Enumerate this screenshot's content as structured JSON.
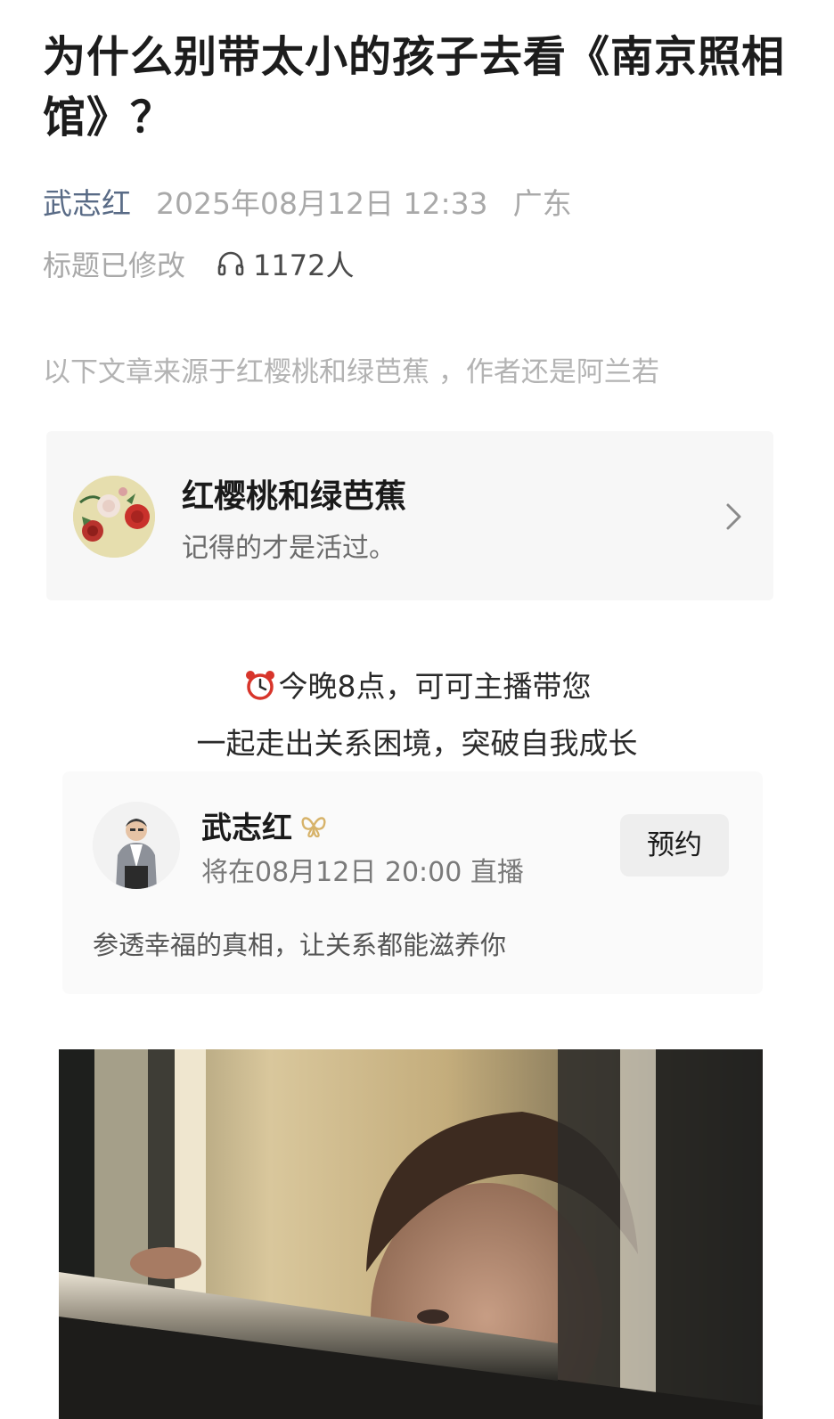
{
  "article": {
    "title": "为什么别带太小的孩子去看《南京照相馆》？",
    "author": "武志红",
    "date": "2025年08月12日 12:33",
    "location": "广东",
    "edited_label": "标题已修改",
    "listeners": "1172人",
    "source_note": "以下文章来源于红樱桃和绿芭蕉 ，作者还是阿兰若"
  },
  "account_card": {
    "name": "红樱桃和绿芭蕉",
    "bio": "记得的才是活过。",
    "icon": "chevron-right-icon"
  },
  "promo": {
    "line1": "今晚8点，可可主播带您",
    "line2": "一起走出关系困境，突破自我成长",
    "icon": "alarm-clock-icon"
  },
  "live_card": {
    "name": "武志红",
    "schedule": "将在08月12日 20:00 直播",
    "reserve_label": "预约",
    "description": "参透幸福的真相，让关系都能滋养你",
    "verify_icon": "butterfly-verified-icon",
    "verify_color": "#d7b36a"
  },
  "colors": {
    "author": "#596b86",
    "meta": "#a9a9a9",
    "card_bg": "#f7f7f7"
  }
}
